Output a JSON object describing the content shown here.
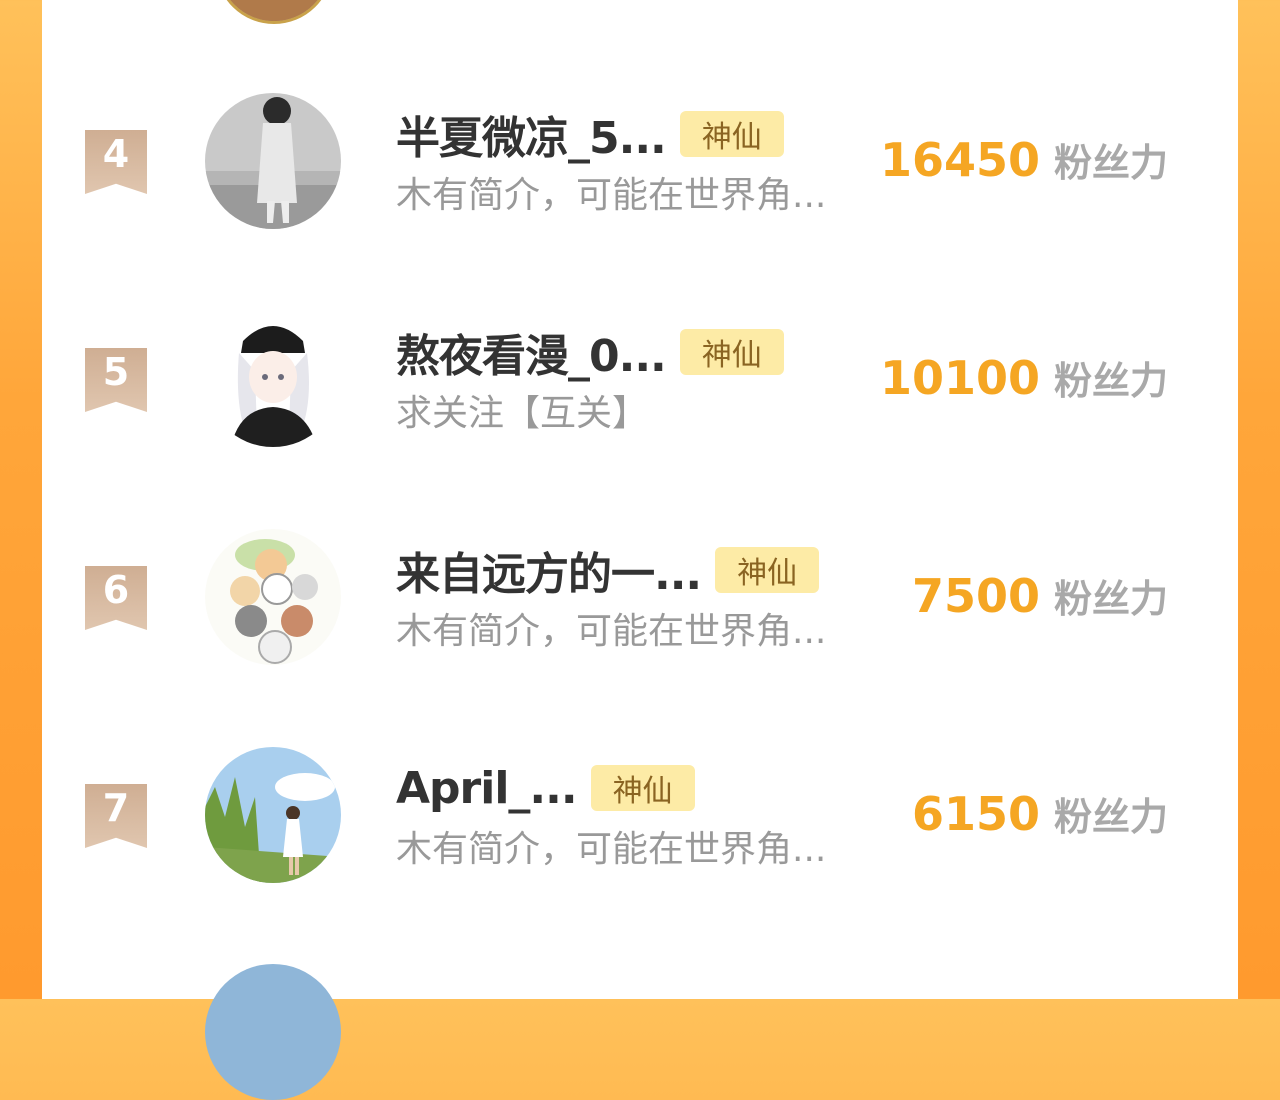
{
  "colors": {
    "background": "#ffa63a",
    "panel": "#ffffff",
    "score": "#f5a623",
    "badge_bg": "#fdeba6",
    "badge_text": "#8a6422",
    "rank_badge": "#d4b59c"
  },
  "ranking": {
    "items": [
      {
        "rank": "4",
        "name": "半夏微凉_5...",
        "title_badge": "神仙",
        "bio": "木有简介，可能在世界角...",
        "score": "16450",
        "unit": "粉丝力",
        "avatar_icon": "girl-photo-avatar"
      },
      {
        "rank": "5",
        "name": "熬夜看漫_0...",
        "title_badge": "神仙",
        "bio": "求关注【互关】",
        "score": "10100",
        "unit": "粉丝力",
        "avatar_icon": "anime-girl-avatar"
      },
      {
        "rank": "6",
        "name": "来自远方的一...",
        "title_badge": "神仙",
        "bio": "木有简介，可能在世界角...",
        "score": "7500",
        "unit": "粉丝力",
        "avatar_icon": "cats-avatar"
      },
      {
        "rank": "7",
        "name": "April_...",
        "title_badge": "神仙",
        "bio": "木有简介，可能在世界角...",
        "score": "6150",
        "unit": "粉丝力",
        "avatar_icon": "meadow-girl-avatar"
      }
    ]
  }
}
